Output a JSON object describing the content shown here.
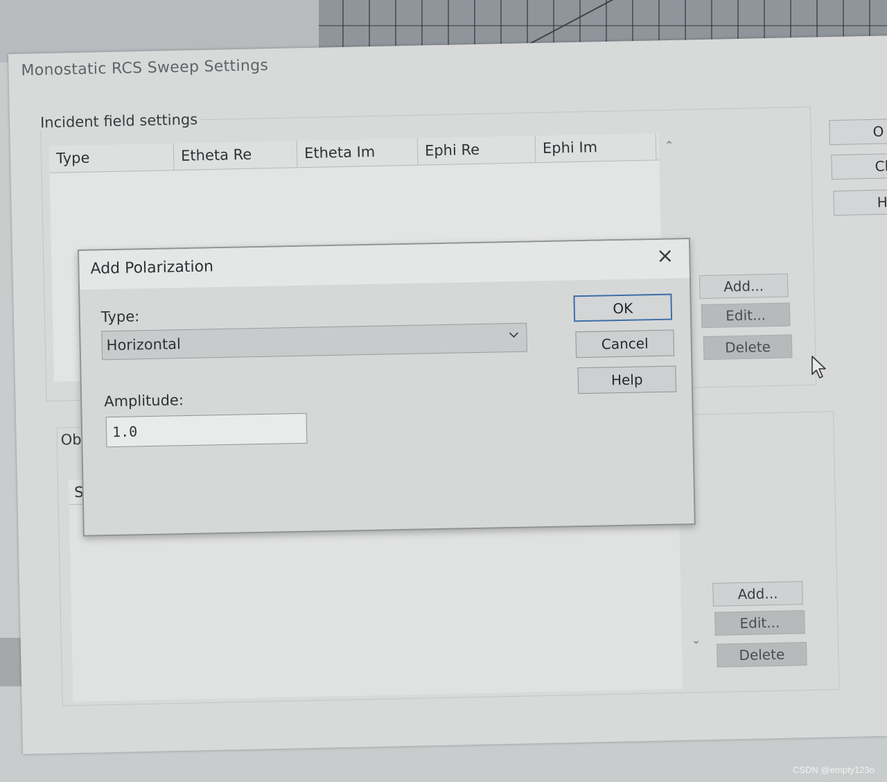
{
  "main_window": {
    "title": "Monostatic RCS Sweep Settings",
    "incident_group_label": "Incident field settings",
    "columns": [
      "Type",
      "Etheta Re",
      "Etheta Im",
      "Ephi Re",
      "Ephi Im"
    ],
    "incident_buttons": {
      "add": "Add...",
      "edit": "Edit...",
      "delete": "Delete"
    },
    "right_buttons": {
      "ok": "O",
      "close": "Clo",
      "help": "He"
    },
    "observe_group_label": "Obse",
    "observe_column": "Sw",
    "observe_buttons": {
      "add": "Add...",
      "edit": "Edit...",
      "delete": "Delete"
    }
  },
  "dialog": {
    "title": "Add Polarization",
    "type_label": "Type:",
    "type_value": "Horizontal",
    "amplitude_label": "Amplitude:",
    "amplitude_value": "1.0",
    "ok_label": "OK",
    "cancel_label": "Cancel",
    "help_label": "Help",
    "close_icon": "close-icon"
  },
  "watermark": "CSDN @empty123o"
}
